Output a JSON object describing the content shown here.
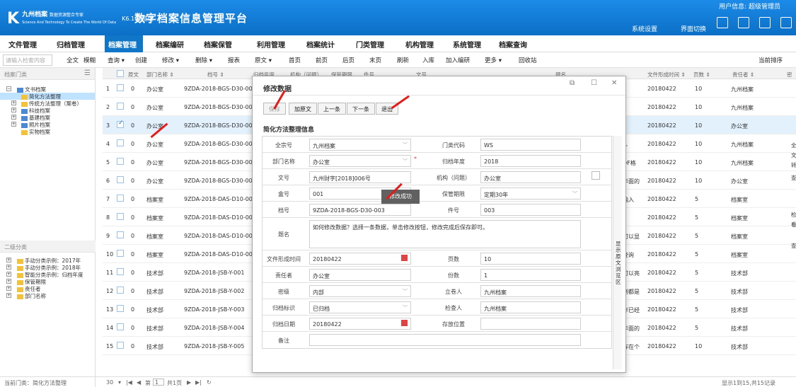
{
  "colors": {
    "brand": "#0b6fc6",
    "accent": "#e31b1b"
  },
  "header": {
    "logo_cn": "九州档案",
    "logo_tag": "数据资源整合专家",
    "logo_en": "Science And Technology To Create The World Of Data",
    "version": "K6.1 标准版",
    "title": "数字档案信息管理平台",
    "user_info": "用户信息: 超级管理员",
    "system_settings": "系统设置",
    "ui_switch": "界面切换"
  },
  "menu": [
    "文件管理",
    "归档管理",
    "档案管理",
    "档案编研",
    "档案保管",
    "利用管理",
    "档案统计",
    "门类管理",
    "机构管理",
    "系统管理",
    "档案查询"
  ],
  "toolbar": {
    "search_placeholder": "请输入检索内容",
    "fulltext": "全文",
    "fuzzy": "模糊",
    "items": [
      "查询 ▾",
      "创建",
      "修改 ▾",
      "删除 ▾",
      "报表",
      "原文 ▾",
      "首页",
      "前页",
      "后页",
      "末页",
      "刷新",
      "入库",
      "加入编研",
      "更多 ▾",
      "回收站"
    ],
    "sort": "当前排序"
  },
  "left": {
    "header": "档案门类",
    "tree": [
      {
        "label": "文书档案",
        "expand": "⊟",
        "folder": "blue"
      },
      {
        "label": "简化方法整理",
        "folder": "yellow",
        "selected": true
      },
      {
        "label": "传统方法整理（案卷）",
        "expand": "⊞",
        "folder": "yellow"
      },
      {
        "label": "科技档案",
        "expand": "⊞",
        "folder": "blue"
      },
      {
        "label": "基建档案",
        "expand": "⊞",
        "folder": "blue"
      },
      {
        "label": "照片档案",
        "expand": "⊞",
        "folder": "blue"
      },
      {
        "label": "实物档案",
        "folder": "yellow"
      }
    ],
    "header2": "二级分类",
    "tree2": [
      {
        "label": "手动分类示例：2017年",
        "expand": "⊞"
      },
      {
        "label": "手动分类示例：2018年",
        "expand": "⊞"
      },
      {
        "label": "智能分类示例：归档年度",
        "expand": "⊞"
      },
      {
        "label": "保管期限",
        "expand": "⊞"
      },
      {
        "label": "责任者",
        "expand": "⊞"
      },
      {
        "label": "部门名称",
        "expand": "⊞"
      }
    ]
  },
  "grid": {
    "headers": [
      "原文",
      "部门名称 ⇕",
      "档号 ⇕",
      "归档年度",
      "机构（问题）",
      "保管期限",
      "件号",
      "文号",
      "题名",
      "文件形成时间 ⇕",
      "页数 ⇕",
      "责任者 ⇕",
      "密"
    ],
    "rows": [
      {
        "n": "1",
        "yw": "0",
        "dept": "办公室",
        "dh": "9ZDA-2018-BGS-D30-001",
        "date": "20180422",
        "pages": "10",
        "zrz": "九州档案",
        "extra": ""
      },
      {
        "n": "2",
        "yw": "0",
        "dept": "办公室",
        "dh": "9ZDA-2018-BGS-D30-002",
        "date": "20180422",
        "pages": "10",
        "zrz": "九州档案",
        "extra": ""
      },
      {
        "n": "3",
        "yw": "0",
        "dept": "办公室",
        "dh": "9ZDA-2018-BGS-D30-003",
        "date": "20180422",
        "pages": "10",
        "zrz": "办公室",
        "extra": "",
        "checked": true
      },
      {
        "n": "4",
        "yw": "0",
        "dept": "办公室",
        "dh": "9ZDA-2018-BGS-D30-004",
        "date": "20180422",
        "pages": "10",
        "zrz": "九州档案",
        "extra": "F,"
      },
      {
        "n": "5",
        "yw": "0",
        "dept": "办公室",
        "dh": "9ZDA-2018-BGS-D30-005",
        "date": "20180422",
        "pages": "10",
        "zrz": "九州档案",
        "extra": "DF格"
      },
      {
        "n": "6",
        "yw": "0",
        "dept": "办公室",
        "dh": "9ZDA-2018-BGS-D30-006",
        "date": "20180422",
        "pages": "10",
        "zrz": "办公室",
        "extra": "华面的"
      },
      {
        "n": "7",
        "yw": "0",
        "dept": "档案室",
        "dh": "9ZDA-2018-DAS-D10-001",
        "date": "20180422",
        "pages": "5",
        "zrz": "档案室",
        "extra": "输入"
      },
      {
        "n": "8",
        "yw": "0",
        "dept": "档案室",
        "dh": "9ZDA-2018-DAS-D10-002",
        "date": "20180422",
        "pages": "5",
        "zrz": "档案室",
        "extra": ""
      },
      {
        "n": "9",
        "yw": "0",
        "dept": "档案室",
        "dh": "9ZDA-2018-DAS-D10-003",
        "date": "20180422",
        "pages": "5",
        "zrz": "档案室",
        "extra": "可以显"
      },
      {
        "n": "10",
        "yw": "0",
        "dept": "档案室",
        "dh": "9ZDA-2018-DAS-D10-004",
        "date": "20180422",
        "pages": "5",
        "zrz": "档案室",
        "extra": "查询"
      },
      {
        "n": "11",
        "yw": "0",
        "dept": "技术部",
        "dh": "9ZDA-2018-JSB-Y-001",
        "date": "20180422",
        "pages": "5",
        "zrz": "技术部",
        "extra": "可以亮"
      },
      {
        "n": "12",
        "yw": "0",
        "dept": "技术部",
        "dh": "9ZDA-2018-JSB-Y-002",
        "date": "20180422",
        "pages": "5",
        "zrz": "技术部",
        "extra": "到都是"
      },
      {
        "n": "13",
        "yw": "0",
        "dept": "技术部",
        "dh": "9ZDA-2018-JSB-Y-003",
        "date": "20180422",
        "pages": "5",
        "zrz": "技术部",
        "extra": "作已经"
      },
      {
        "n": "14",
        "yw": "0",
        "dept": "技术部",
        "dh": "9ZDA-2018-JSB-Y-004",
        "date": "20180422",
        "pages": "5",
        "zrz": "技术部",
        "extra": "华面的"
      },
      {
        "n": "15",
        "yw": "0",
        "dept": "技术部",
        "dh": "9ZDA-2018-JSB-Y-005",
        "date": "20180422",
        "pages": "10",
        "zrz": "技术部",
        "extra": "存在个"
      }
    ]
  },
  "status": {
    "current": "当前门类：简化方法整理",
    "pagesize": "30",
    "page_label": "第",
    "page": "1",
    "total_pages": "共1页",
    "summary": "显示1到15,共15记录"
  },
  "modal": {
    "title": "修改数据",
    "buttons": [
      "保存",
      "加原文",
      "上一条",
      "下一条",
      "退出"
    ],
    "section": "简化方法整理信息",
    "fields": {
      "qzh_label": "全宗号",
      "qzh": "九州档案",
      "mldm_label": "门类代码",
      "mldm": "WS",
      "bmmc_label": "部门名称",
      "bmmc": "办公室",
      "gdnd_label": "归档年度",
      "gdnd": "2018",
      "wh_label": "文号",
      "wh": "九州财字[2018]006号",
      "jg_label": "机构（问题）",
      "jg": "办公室",
      "hh_label": "盒号",
      "hh": "001",
      "bgqx_label": "保管期限",
      "bgqx": "定期30年",
      "dh_label": "档号",
      "dh": "9ZDA-2018-BGS-D30-003",
      "jh_label": "件号",
      "jh": "003",
      "tm_label": "题名",
      "tm": "如何修改数据？选择一条数据，单击修改按钮，修改完成后保存即可。",
      "wjxcsj_label": "文件形成时间",
      "wjxcsj": "20180422",
      "ys_label": "页数",
      "ys": "10",
      "zrz_label": "责任者",
      "zrz": "办公室",
      "fs_label": "份数",
      "fs": "1",
      "mj_label": "密级",
      "mj": "内部",
      "ljr_label": "立卷人",
      "ljr": "九州档案",
      "gdbs_label": "归档标识",
      "gdbs": "已归档",
      "jcr_label": "检查人",
      "jcr": "九州档案",
      "gdrq_label": "归档日期",
      "gdrq": "20180422",
      "cfwz_label": "存放位置",
      "cfwz": "",
      "bz_label": "备注",
      "bz": ""
    },
    "side_label": "显示原文浏览区",
    "toast": "修改成功"
  },
  "edge": {
    "a": "全",
    "b": "文",
    "c": "转",
    "d": "查",
    "e": "查",
    "f": "看",
    "g": "检"
  }
}
